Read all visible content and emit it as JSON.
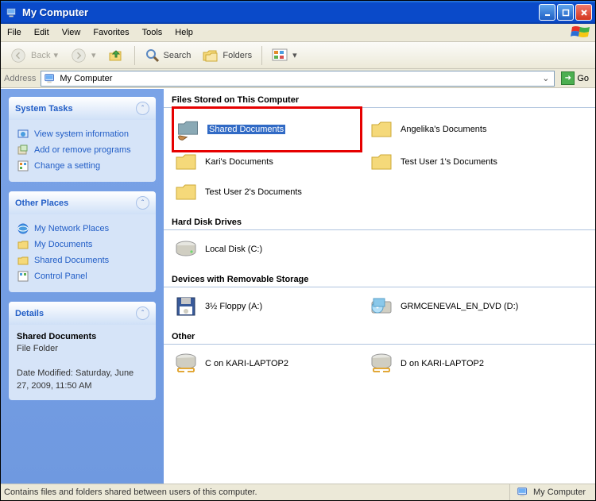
{
  "window": {
    "title": "My Computer"
  },
  "menu": {
    "file": "File",
    "edit": "Edit",
    "view": "View",
    "favorites": "Favorites",
    "tools": "Tools",
    "help": "Help"
  },
  "toolbar": {
    "back": "Back",
    "search": "Search",
    "folders": "Folders"
  },
  "address": {
    "label": "Address",
    "value": "My Computer",
    "go": "Go"
  },
  "tasks": {
    "system": {
      "title": "System Tasks",
      "items": [
        {
          "label": "View system information"
        },
        {
          "label": "Add or remove programs"
        },
        {
          "label": "Change a setting"
        }
      ]
    },
    "other": {
      "title": "Other Places",
      "items": [
        {
          "label": "My Network Places"
        },
        {
          "label": "My Documents"
        },
        {
          "label": "Shared Documents"
        },
        {
          "label": "Control Panel"
        }
      ]
    },
    "details": {
      "title": "Details",
      "name": "Shared Documents",
      "type": "File Folder",
      "modified_label": "Date Modified:",
      "modified_value": "Saturday, June 27, 2009, 11:50 AM"
    }
  },
  "content": {
    "section1": {
      "title": "Files Stored on This Computer",
      "items": [
        {
          "label": "Shared Documents",
          "icon": "shared-folder",
          "selected": true,
          "highlight": true
        },
        {
          "label": "Angelika's Documents",
          "icon": "folder"
        },
        {
          "label": "Kari's Documents",
          "icon": "folder"
        },
        {
          "label": "Test User 1's Documents",
          "icon": "folder"
        },
        {
          "label": "Test User 2's Documents",
          "icon": "folder"
        }
      ]
    },
    "section2": {
      "title": "Hard Disk Drives",
      "items": [
        {
          "label": "Local Disk (C:)",
          "icon": "hdd"
        }
      ]
    },
    "section3": {
      "title": "Devices with Removable Storage",
      "items": [
        {
          "label": "3½ Floppy (A:)",
          "icon": "floppy"
        },
        {
          "label": "GRMCENEVAL_EN_DVD (D:)",
          "icon": "dvd"
        }
      ]
    },
    "section4": {
      "title": "Other",
      "items": [
        {
          "label": "C on KARI-LAPTOP2",
          "icon": "netdrive"
        },
        {
          "label": "D on KARI-LAPTOP2",
          "icon": "netdrive"
        }
      ]
    }
  },
  "status": {
    "text": "Contains files and folders shared between users of this computer.",
    "location": "My Computer"
  }
}
